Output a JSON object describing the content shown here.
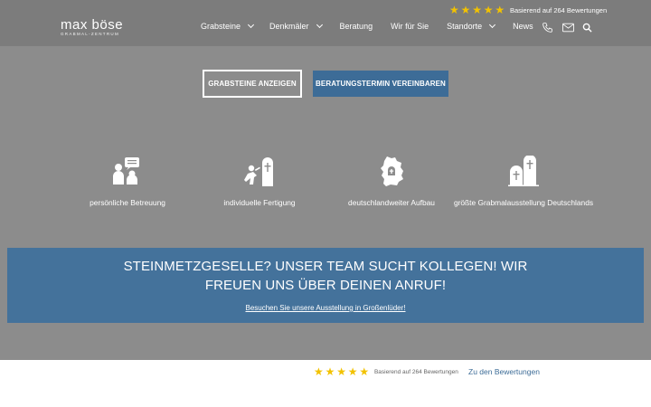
{
  "brand": {
    "name": "max böse",
    "sub": "GRABMAL-ZENTRUM"
  },
  "top_rating": {
    "stars": 5,
    "text": "Basierend auf 264 Bewertungen"
  },
  "nav": {
    "items": [
      {
        "label": "Grabsteine",
        "dropdown": true
      },
      {
        "label": "Denkmäler",
        "dropdown": true
      },
      {
        "label": "Beratung",
        "dropdown": false
      },
      {
        "label": "Wir für Sie",
        "dropdown": false
      },
      {
        "label": "Standorte",
        "dropdown": true
      },
      {
        "label": "News",
        "dropdown": false
      }
    ],
    "icons": [
      "phone-icon",
      "mail-icon",
      "search-icon"
    ]
  },
  "cta": {
    "primary_label": "GRABSTEINE ANZEIGEN",
    "secondary_label": "BERATUNGSTERMIN VEREINBAREN"
  },
  "features": [
    {
      "icon": "consultation-icon",
      "label": "persönliche Betreuung"
    },
    {
      "icon": "stonemason-icon",
      "label": "individuelle Fertigung"
    },
    {
      "icon": "germany-map-icon",
      "label": "deutschlandweiter Aufbau"
    },
    {
      "icon": "gravestones-icon",
      "label": "größte Grabmalausstellung Deutschlands"
    }
  ],
  "banner": {
    "title_line1": "STEINMETZGESELLE? UNSER TEAM SUCHT KOLLEGEN! WIR",
    "title_line2": "FREUEN UNS ÜBER DEINEN ANRUF!",
    "link": "Besuchen Sie unsere Ausstellung in Großenlüder!"
  },
  "bottom_rating": {
    "stars": 5,
    "text": "Basierend auf 264 Bewertungen",
    "link": "Zu den Bewertungen"
  },
  "colors": {
    "background": "#8c8c8c",
    "header": "#7c7c7c",
    "accent_blue": "#3d6c97",
    "banner_blue": "#44729b",
    "star": "#f2c200"
  }
}
